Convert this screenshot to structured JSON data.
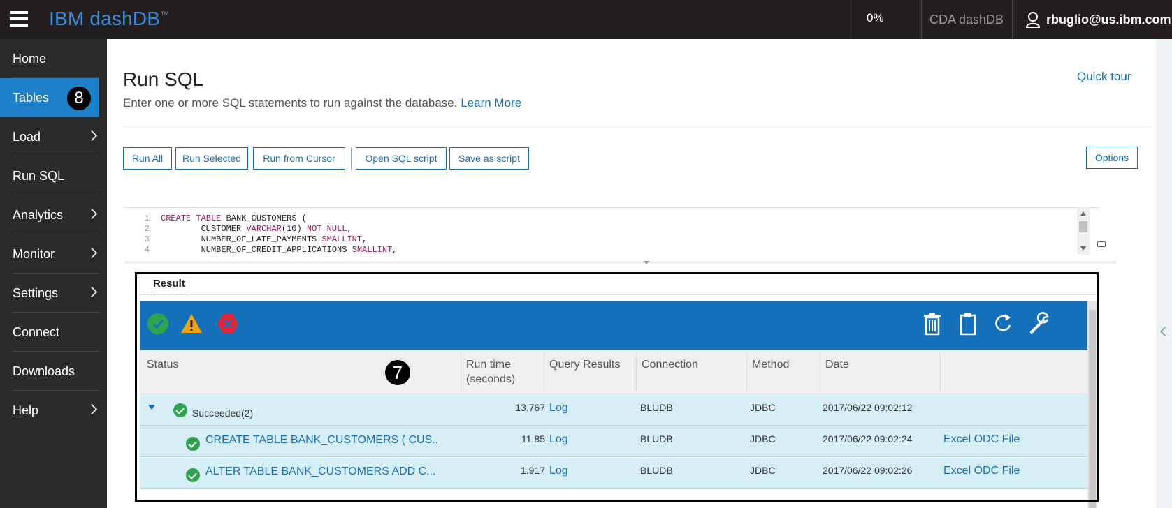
{
  "header": {
    "brand": "IBM dashDB",
    "brand_tm": "™",
    "progress": "0%",
    "instance": "CDA dashDB",
    "user": "rbuglio@us.ibm.com"
  },
  "sidebar": {
    "items": [
      {
        "label": "Home"
      },
      {
        "label": "Tables",
        "badge": "8"
      },
      {
        "label": "Load"
      },
      {
        "label": "Run SQL"
      },
      {
        "label": "Analytics"
      },
      {
        "label": "Monitor"
      },
      {
        "label": "Settings"
      },
      {
        "label": "Connect"
      },
      {
        "label": "Downloads"
      },
      {
        "label": "Help"
      }
    ]
  },
  "page": {
    "title": "Run SQL",
    "description": "Enter one or more SQL statements to run against the database.",
    "learn_more": "Learn More",
    "quick_tour": "Quick tour"
  },
  "toolbar": {
    "run_all": "Run All",
    "run_selected": "Run Selected",
    "run_from_cursor": "Run from Cursor",
    "open_script": "Open SQL script",
    "save_script": "Save as script",
    "options": "Options"
  },
  "editor": {
    "lines": [
      {
        "n": "1",
        "kw1": "CREATE TABLE",
        "rest": " BANK_CUSTOMERS ("
      },
      {
        "n": "2",
        "pre": "        CUSTOMER ",
        "kw1": "VARCHAR",
        "mid": "(10) ",
        "kw2": "NOT NULL",
        "rest": ","
      },
      {
        "n": "3",
        "pre": "        NUMBER_OF_LATE_PAYMENTS ",
        "kw1": "SMALLINT",
        "rest": ","
      },
      {
        "n": "4",
        "pre": "        NUMBER_OF_CREDIT_APPLICATIONS ",
        "kw1": "SMALLINT",
        "rest": ","
      }
    ]
  },
  "result": {
    "tab_label": "Result",
    "badge": "7",
    "columns": {
      "status": "Status",
      "run_time_1": "Run time",
      "run_time_2": "(seconds)",
      "query_results": "Query Results",
      "connection": "Connection",
      "method": "Method",
      "date": "Date"
    },
    "summary": {
      "status": "Succeeded(2)",
      "run_time": "13.767",
      "query_results": "Log",
      "connection": "BLUDB",
      "method": "JDBC",
      "date": "2017/06/22 09:02:12"
    },
    "rows": [
      {
        "statement": "CREATE TABLE BANK_CUSTOMERS ( CUS..",
        "run_time": "11.85",
        "query_results": "Log",
        "connection": "BLUDB",
        "method": "JDBC",
        "date": "2017/06/22 09:02:24",
        "export": "Excel ODC File"
      },
      {
        "statement": "ALTER TABLE BANK_CUSTOMERS ADD C...",
        "run_time": "1.917",
        "query_results": "Log",
        "connection": "BLUDB",
        "method": "JDBC",
        "date": "2017/06/22 09:02:26",
        "export": "Excel ODC File"
      }
    ]
  },
  "colors": {
    "accent": "#1a6fb5",
    "toolbar_blue": "#1470b8",
    "sidebar_bg": "#2b2b2b",
    "topbar_bg": "#231f20",
    "row_bg": "#d6eef6",
    "success": "#2ea44f",
    "warning": "#f0a30a",
    "error": "#e0263c"
  },
  "icons": {
    "menu": "hamburger-menu-icon",
    "user": "user-icon",
    "status_success": "check-circle-icon",
    "status_warning": "warning-triangle-icon",
    "status_error": "error-hexagon-icon",
    "delete": "trash-icon",
    "clear": "clipboard-icon",
    "refresh": "refresh-icon",
    "settings": "wrench-icon"
  }
}
